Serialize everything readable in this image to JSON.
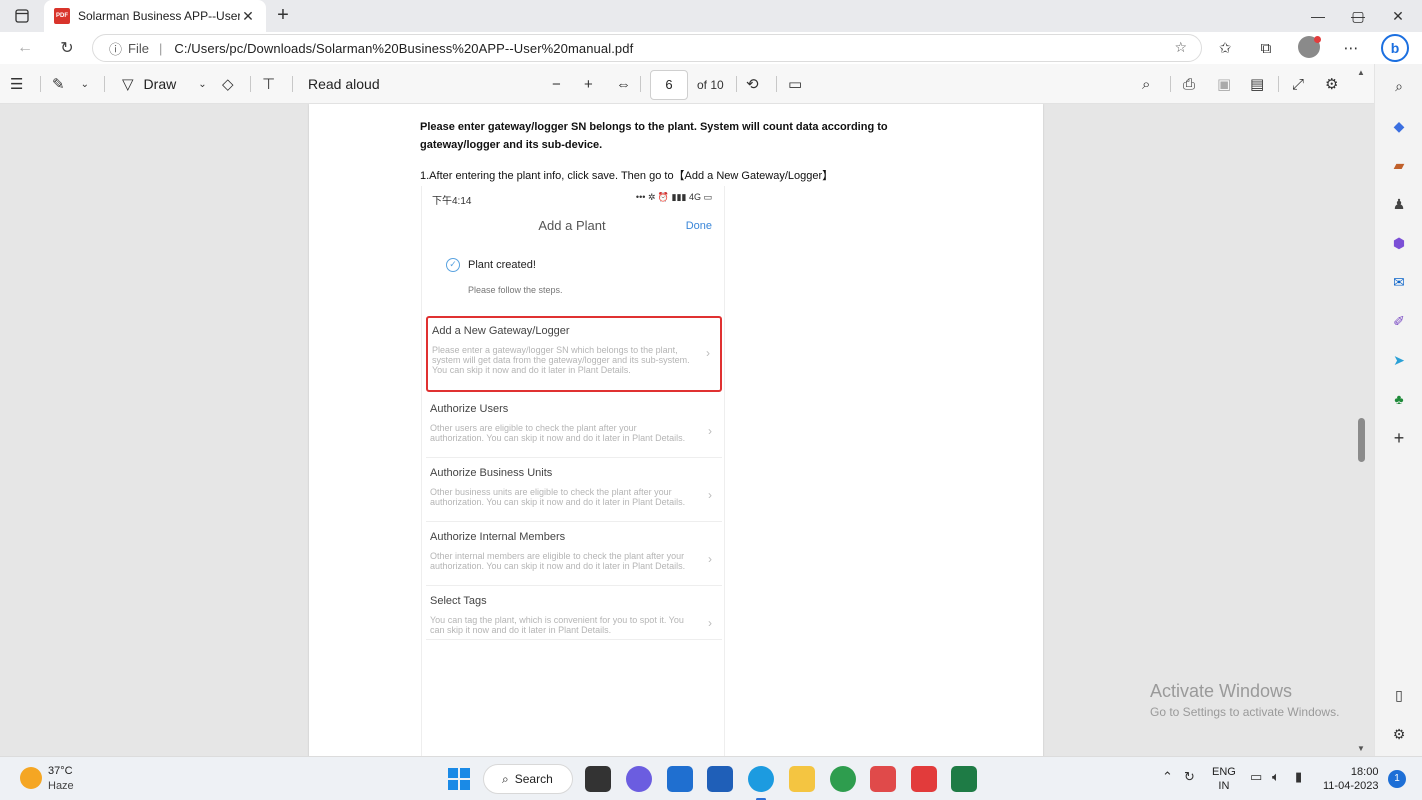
{
  "browser": {
    "tab_title": "Solarman Business APP--User manual.pdf",
    "tab_icon_label": "PDF",
    "file_label": "File",
    "separator": "|",
    "url": "C:/Users/pc/Downloads/Solarman%20Business%20APP--User%20manual.pdf",
    "bing_label": "b"
  },
  "pdf_toolbar": {
    "draw_label": "Draw",
    "read_aloud_label": "Read aloud",
    "current_page": "6",
    "page_of": "of 10"
  },
  "document": {
    "heading": "Please enter gateway/logger SN belongs to the plant. System will count data according to gateway/logger and its sub-device.",
    "step_text": "1.After entering the plant info, click save. Then go to【Add a New Gateway/Logger】",
    "phone": {
      "time": "下午4:14",
      "status_icons": "... ✲ ⏰ ⁴ᴳ 4G ▭",
      "title": "Add a Plant",
      "done": "Done",
      "created": "Plant created!",
      "follow": "Please follow the steps.",
      "steps": [
        {
          "title": "Add a New Gateway/Logger",
          "desc": "Please enter a gateway/logger SN which belongs to the plant, system will get data from the gateway/logger and its sub-system. You can skip it now and do it later in Plant Details."
        },
        {
          "title": "Authorize Users",
          "desc": "Other users are eligible to check the plant after your authorization. You can skip it now and do it later in Plant Details."
        },
        {
          "title": "Authorize Business Units",
          "desc": "Other business units are eligible to check the plant after your authorization. You can skip it now and do it later in Plant Details."
        },
        {
          "title": "Authorize Internal Members",
          "desc": "Other internal members are eligible to check the plant after your authorization. You can skip it now and do it later in Plant Details."
        },
        {
          "title": "Select Tags",
          "desc": "You can tag the plant, which is convenient for you to spot it. You can skip it now and do it later in Plant Details."
        }
      ]
    }
  },
  "watermark": {
    "line1": "Activate Windows",
    "line2": "Go to Settings to activate Windows."
  },
  "taskbar": {
    "temperature": "37°C",
    "condition": "Haze",
    "search_label": "Search",
    "lang_line1": "ENG",
    "lang_line2": "IN",
    "time": "18:00",
    "date": "11-04-2023",
    "notification_count": "1"
  },
  "colors": {
    "highlight": "#e03131",
    "link_blue": "#3a86d8",
    "accent": "#1b6fe0"
  }
}
